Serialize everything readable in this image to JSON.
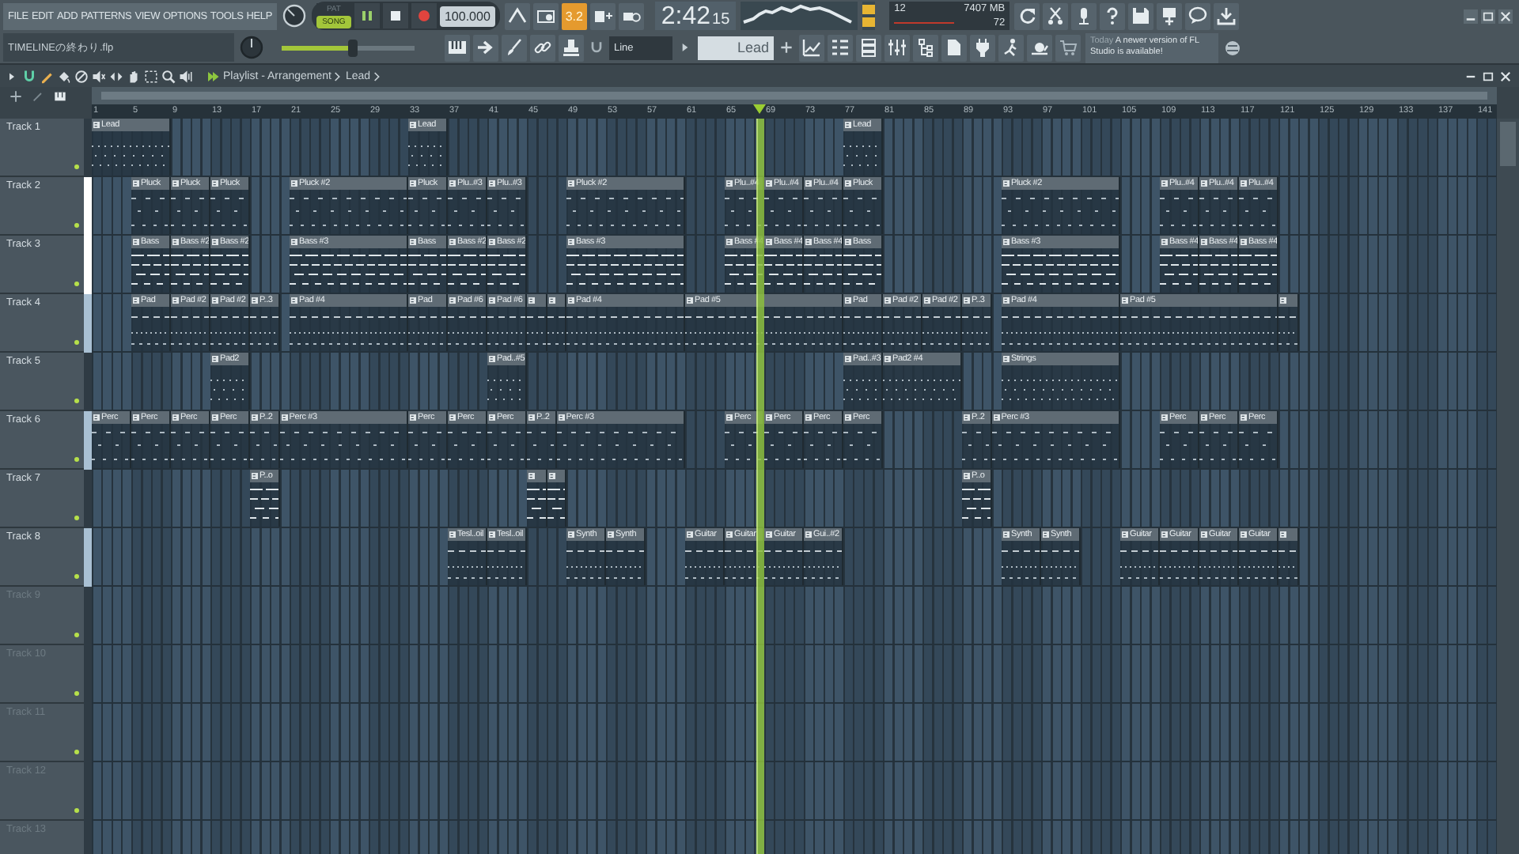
{
  "menu": [
    "FILE",
    "EDIT",
    "ADD",
    "PATTERNS",
    "VIEW",
    "OPTIONS",
    "TOOLS",
    "HELP"
  ],
  "mode": [
    {
      "label": "PAT",
      "selected": false
    },
    {
      "label": "SONG",
      "selected": true
    }
  ],
  "tempo": "100.000",
  "snap": {
    "label": "3.2",
    "on": true
  },
  "time": {
    "main": "2:42",
    "sub": "15"
  },
  "cpu": {
    "cores": "12",
    "memory": "7407 MB",
    "polyphony": "72"
  },
  "file_name": "TIMELINEの終わり.flp",
  "master_volume": {
    "level": 0.53
  },
  "snap_mode": "Line",
  "pattern": "Lead",
  "hint": {
    "when": "Today",
    "message": "A newer version of FL Studio is available!"
  },
  "playlist": {
    "title": "Playlist - Arrangement",
    "breadcrumb": "Lead",
    "ruler": [
      "1",
      "5",
      "9",
      "13",
      "17",
      "21",
      "25",
      "29",
      "33",
      "37",
      "41",
      "45",
      "49",
      "53",
      "57",
      "61",
      "65",
      "69",
      "73",
      "77",
      "81",
      "85",
      "89",
      "93",
      "97",
      "101",
      "105",
      "109",
      "113",
      "117",
      "121",
      "125",
      "129",
      "133",
      "137",
      "141"
    ],
    "tracks": [
      {
        "name": "Track 1",
        "empty": false,
        "clips": [
          {
            "kind": "pattern",
            "label": "Lead"
          },
          {
            "kind": "pattern",
            "label": "Lead"
          },
          {
            "kind": "pattern",
            "label": "Lead"
          }
        ]
      },
      {
        "name": "Track 2",
        "empty": false,
        "color": "#ffffff",
        "clips": [
          {
            "kind": "pattern",
            "label": "Pluck"
          },
          {
            "kind": "pattern",
            "label": "Pluck"
          },
          {
            "kind": "pattern",
            "label": "Pluck"
          },
          {
            "kind": "pattern",
            "label": "Pluck #2"
          },
          {
            "kind": "pattern",
            "label": "Pluck"
          },
          {
            "kind": "pattern",
            "label": "Plu..#3"
          },
          {
            "kind": "pattern",
            "label": "Plu..#3"
          },
          {
            "kind": "pattern",
            "label": "Pluck #2"
          },
          {
            "kind": "pattern",
            "label": "Plu..#4"
          },
          {
            "kind": "pattern",
            "label": "Plu..#4"
          },
          {
            "kind": "pattern",
            "label": "Plu..#4"
          },
          {
            "kind": "pattern",
            "label": "Pluck"
          },
          {
            "kind": "pattern",
            "label": "Pluck #2"
          },
          {
            "kind": "pattern",
            "label": "Plu..#4"
          },
          {
            "kind": "pattern",
            "label": "Plu..#4"
          },
          {
            "kind": "pattern",
            "label": "Plu..#4"
          }
        ]
      },
      {
        "name": "Track 3",
        "empty": false,
        "color": "#ffffff",
        "clips": [
          {
            "kind": "pattern",
            "label": "Bass"
          },
          {
            "kind": "pattern",
            "label": "Bass #2"
          },
          {
            "kind": "pattern",
            "label": "Bass #2"
          },
          {
            "kind": "pattern",
            "label": "Bass #3"
          },
          {
            "kind": "pattern",
            "label": "Bass"
          },
          {
            "kind": "pattern",
            "label": "Bass #2"
          },
          {
            "kind": "pattern",
            "label": "Bass #2"
          },
          {
            "kind": "pattern",
            "label": "Bass #3"
          },
          {
            "kind": "pattern",
            "label": "Bass #4"
          },
          {
            "kind": "pattern",
            "label": "Bass #4"
          },
          {
            "kind": "pattern",
            "label": "Bass #4"
          },
          {
            "kind": "pattern",
            "label": "Bass"
          },
          {
            "kind": "pattern",
            "label": "Bass #3"
          },
          {
            "kind": "pattern",
            "label": "Bass #4"
          },
          {
            "kind": "pattern",
            "label": "Bass #4"
          },
          {
            "kind": "pattern",
            "label": "Bass #4"
          }
        ]
      },
      {
        "name": "Track 4",
        "empty": false,
        "color": "#a9c0d3",
        "clips": [
          {
            "kind": "pattern",
            "label": "Pad"
          },
          {
            "kind": "pattern",
            "label": "Pad #2"
          },
          {
            "kind": "pattern",
            "label": "Pad #2"
          },
          {
            "kind": "pattern",
            "label": "P..3"
          },
          {
            "kind": "pattern",
            "label": "Pad #4"
          },
          {
            "kind": "pattern",
            "label": "Pad"
          },
          {
            "kind": "pattern",
            "label": "Pad #6"
          },
          {
            "kind": "pattern",
            "label": "Pad #6"
          },
          {
            "kind": "pattern"
          },
          {
            "kind": "pattern"
          },
          {
            "kind": "pattern",
            "label": "Pad #4"
          },
          {
            "kind": "pattern",
            "label": "Pad #5"
          },
          {
            "kind": "pattern",
            "label": "Pad"
          },
          {
            "kind": "pattern",
            "label": "Pad #2"
          },
          {
            "kind": "pattern",
            "label": "Pad #2"
          },
          {
            "kind": "pattern",
            "label": "P..3"
          },
          {
            "kind": "pattern",
            "label": "Pad #4"
          },
          {
            "kind": "pattern",
            "label": "Pad #5"
          },
          {
            "kind": "pattern"
          }
        ]
      },
      {
        "name": "Track 5",
        "empty": false,
        "clips": [
          {
            "kind": "pattern",
            "label": "Pad2"
          },
          {
            "kind": "pattern",
            "label": "Pad..#5"
          },
          {
            "kind": "pattern",
            "label": "Pad..#3"
          },
          {
            "kind": "pattern",
            "label": "Pad2 #4"
          },
          {
            "kind": "pattern",
            "label": "Strings"
          }
        ]
      },
      {
        "name": "Track 6",
        "empty": false,
        "color": "#a9c0d3",
        "clips": [
          {
            "kind": "pattern",
            "label": "Perc"
          },
          {
            "kind": "pattern",
            "label": "Perc"
          },
          {
            "kind": "pattern",
            "label": "Perc"
          },
          {
            "kind": "pattern",
            "label": "Perc"
          },
          {
            "kind": "pattern",
            "label": "P..2"
          },
          {
            "kind": "pattern",
            "label": "Perc #3"
          },
          {
            "kind": "pattern",
            "label": "Perc"
          },
          {
            "kind": "pattern",
            "label": "Perc"
          },
          {
            "kind": "pattern",
            "label": "Perc"
          },
          {
            "kind": "pattern",
            "label": "P..2"
          },
          {
            "kind": "pattern",
            "label": "Perc #3"
          },
          {
            "kind": "pattern",
            "label": "Perc"
          },
          {
            "kind": "pattern",
            "label": "Perc"
          },
          {
            "kind": "pattern",
            "label": "Perc"
          },
          {
            "kind": "pattern",
            "label": "Perc"
          },
          {
            "kind": "pattern",
            "label": "P..2"
          },
          {
            "kind": "pattern",
            "label": "Perc #3"
          },
          {
            "kind": "pattern",
            "label": "Perc"
          },
          {
            "kind": "pattern",
            "label": "Perc"
          },
          {
            "kind": "pattern",
            "label": "Perc"
          }
        ]
      },
      {
        "name": "Track 7",
        "empty": false,
        "clips": [
          {
            "kind": "pattern",
            "label": "P..o"
          },
          {
            "kind": "pattern"
          },
          {
            "kind": "pattern"
          },
          {
            "kind": "pattern",
            "label": "P..o"
          }
        ]
      },
      {
        "name": "Track 8",
        "empty": false,
        "color": "#a9c0d3",
        "clips": [
          {
            "kind": "pattern",
            "label": "Tesl..oil"
          },
          {
            "kind": "pattern",
            "label": "Tesl..oil"
          },
          {
            "kind": "pattern",
            "label": "Synth"
          },
          {
            "kind": "pattern",
            "label": "Synth"
          },
          {
            "kind": "pattern",
            "label": "Guitar"
          },
          {
            "kind": "pattern",
            "label": "Guitar"
          },
          {
            "kind": "pattern",
            "label": "Guitar"
          },
          {
            "kind": "pattern",
            "label": "Gui..#2"
          },
          {
            "kind": "pattern",
            "label": "Synth"
          },
          {
            "kind": "pattern",
            "label": "Synth"
          },
          {
            "kind": "pattern",
            "label": "Guitar"
          },
          {
            "kind": "pattern",
            "label": "Guitar"
          },
          {
            "kind": "pattern",
            "label": "Guitar"
          },
          {
            "kind": "pattern",
            "label": "Guitar"
          },
          {
            "kind": "pattern"
          }
        ]
      },
      {
        "name": "Track 9",
        "empty": true
      },
      {
        "name": "Track 10",
        "empty": true
      },
      {
        "name": "Track 11",
        "empty": true
      },
      {
        "name": "Track 12",
        "empty": true
      },
      {
        "name": "Track 13",
        "empty": true
      }
    ]
  }
}
